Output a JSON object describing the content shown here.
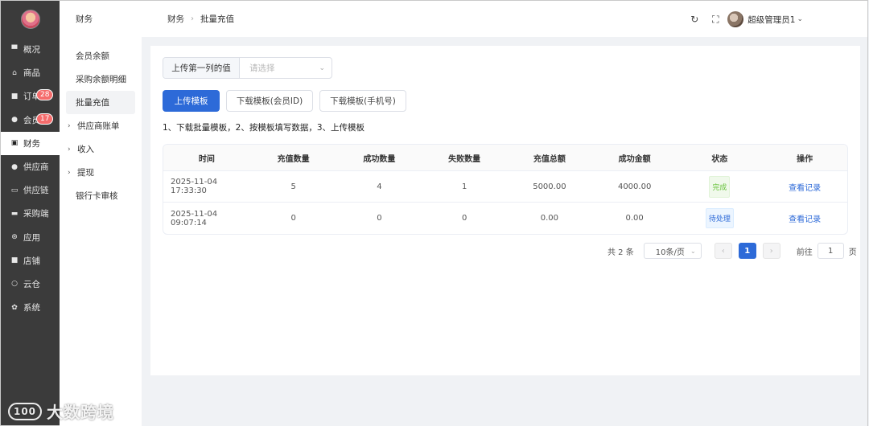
{
  "nav": {
    "items": [
      {
        "label": "概况",
        "icon": "monitor-icon"
      },
      {
        "label": "商品",
        "icon": "bag-icon"
      },
      {
        "label": "订单",
        "icon": "clipboard-icon",
        "badge": "28"
      },
      {
        "label": "会员",
        "icon": "user-icon",
        "badge": "17"
      },
      {
        "label": "财务",
        "icon": "wallet-icon",
        "active": true
      },
      {
        "label": "供应商",
        "icon": "user-icon"
      },
      {
        "label": "供应链",
        "icon": "truck-icon"
      },
      {
        "label": "采购端",
        "icon": "cart-icon"
      },
      {
        "label": "应用",
        "icon": "grid-icon"
      },
      {
        "label": "店铺",
        "icon": "store-icon"
      },
      {
        "label": "云仓",
        "icon": "cloud-icon"
      },
      {
        "label": "系统",
        "icon": "gear-icon"
      }
    ]
  },
  "submenu": {
    "title": "财务",
    "items": [
      {
        "label": "会员余额"
      },
      {
        "label": "采购余额明细"
      },
      {
        "label": "批量充值"
      },
      {
        "label": "供应商账单"
      },
      {
        "label": "收入"
      },
      {
        "label": "提现"
      },
      {
        "label": "银行卡审核"
      }
    ]
  },
  "header": {
    "breadcrumb": [
      "财务",
      "批量充值"
    ],
    "username": "超级管理员1"
  },
  "form": {
    "upload_label": "上传第一列的值",
    "select_placeholder": "请选择"
  },
  "buttons": {
    "upload": "上传模板",
    "download_member": "下载模板(会员ID)",
    "download_phone": "下载模板(手机号)"
  },
  "instructions": "1、下载批量模板，2、按模板填写数据，3、上传模板",
  "table": {
    "columns": [
      "时间",
      "充值数量",
      "成功数量",
      "失败数量",
      "充值总额",
      "成功金额",
      "状态",
      "操作"
    ],
    "rows": [
      {
        "time": "2025-11-04 17:33:30",
        "count": "5",
        "success": "4",
        "fail": "1",
        "total": "5000.00",
        "success_amount": "4000.00",
        "status": "完成",
        "action": "查看记录"
      },
      {
        "time": "2025-11-04 09:07:14",
        "count": "0",
        "success": "0",
        "fail": "0",
        "total": "0.00",
        "success_amount": "0.00",
        "status": "待处理",
        "action": "查看记录"
      }
    ]
  },
  "pagination": {
    "total": "共 2 条",
    "page_size": "10条/页",
    "prev": "‹",
    "current": "1",
    "next": "›",
    "goto_label": "前往",
    "goto_value": "1",
    "page_unit": "页"
  },
  "watermark": {
    "text": "大数跨境",
    "logo": "100"
  },
  "colors": {
    "primary": "#2d6ad8",
    "nav_bg": "#3b3b3b",
    "badge": "#f56c6c",
    "success": "#67c23a"
  }
}
